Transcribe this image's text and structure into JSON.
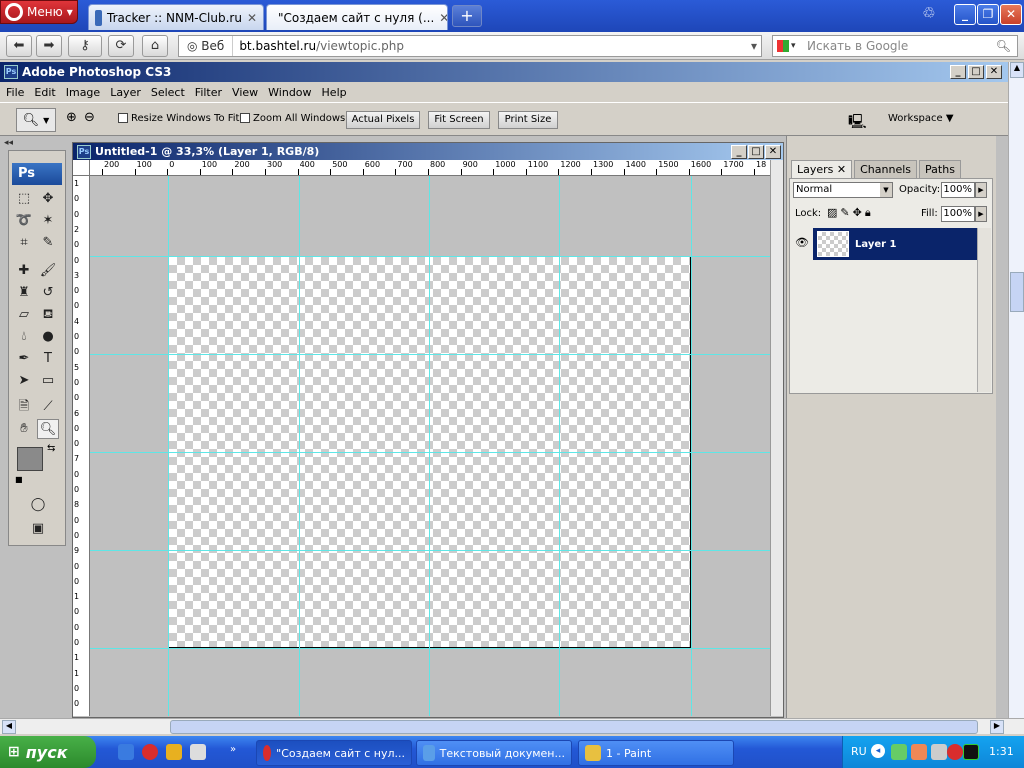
{
  "opera": {
    "menu_label": "Меню",
    "tabs": [
      {
        "label": "Tracker :: NNM-Club.ru"
      },
      {
        "label": "\"Создаем сайт с нуля (..."
      }
    ],
    "new_tab": "+",
    "address": {
      "prefix": "Веб",
      "url_domain": "bt.bashtel.ru",
      "url_path": "/viewtopic.php"
    },
    "search_placeholder": "Искать в Google"
  },
  "photoshop": {
    "app_title": "Adobe Photoshop CS3",
    "menu": [
      "File",
      "Edit",
      "Image",
      "Layer",
      "Select",
      "Filter",
      "View",
      "Window",
      "Help"
    ],
    "options": {
      "resize_windows": "Resize Windows To Fit",
      "zoom_all": "Zoom All Windows",
      "actual_pixels": "Actual Pixels",
      "fit_screen": "Fit Screen",
      "print_size": "Print Size",
      "workspace": "Workspace"
    },
    "toolbox_logo": "Ps",
    "document": {
      "title": "Untitled-1 @ 33,3% (Layer 1, RGB/8)",
      "ruler_top": [
        "200",
        "100",
        "0",
        "100",
        "200",
        "300",
        "400",
        "500",
        "600",
        "700",
        "800",
        "900",
        "1000",
        "1100",
        "1200",
        "1300",
        "1400",
        "1500",
        "1600",
        "1700",
        "18"
      ],
      "ruler_left": [
        "1",
        "0",
        "0",
        "2",
        "0",
        "0",
        "3",
        "0",
        "0",
        "4",
        "0",
        "0",
        "5",
        "0",
        "0",
        "6",
        "0",
        "0",
        "7",
        "0",
        "0",
        "8",
        "0",
        "0",
        "9",
        "0",
        "0",
        "1",
        "0",
        "0",
        "0",
        "1",
        "1",
        "0",
        "0"
      ]
    },
    "layers_panel": {
      "tabs": [
        "Layers",
        "Channels",
        "Paths"
      ],
      "blend_mode": "Normal",
      "opacity_label": "Opacity:",
      "opacity_value": "100%",
      "lock_label": "Lock:",
      "fill_label": "Fill:",
      "fill_value": "100%",
      "layer_name": "Layer 1"
    }
  },
  "taskbar": {
    "start_label": "пуск",
    "tasks": [
      {
        "label": "\"Создаем сайт с нул..."
      },
      {
        "label": "Текстовый докумен..."
      },
      {
        "label": "1 - Paint"
      }
    ],
    "lang": "RU",
    "clock": "1:31"
  }
}
